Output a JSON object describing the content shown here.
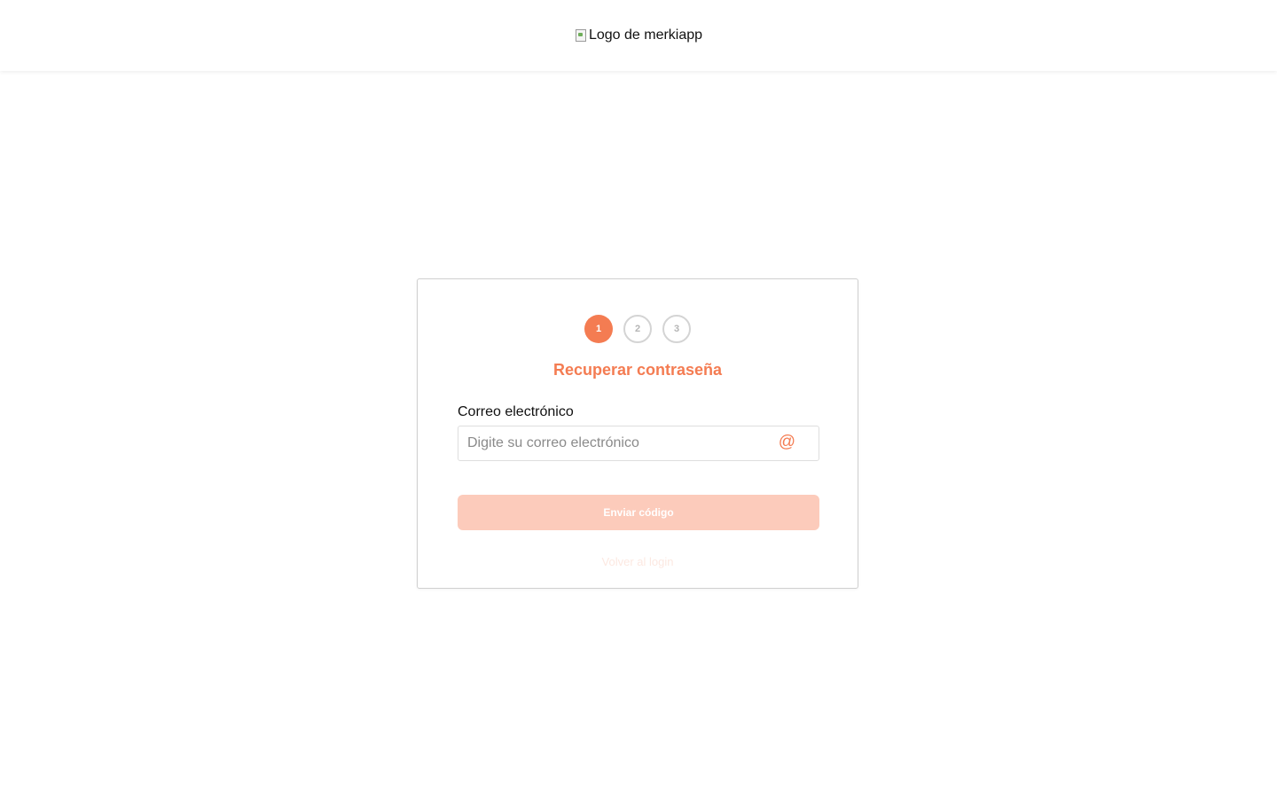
{
  "header": {
    "logo_alt": "Logo de merkiapp"
  },
  "stepper": {
    "steps": [
      "1",
      "2",
      "3"
    ],
    "active_step": 1
  },
  "form": {
    "title": "Recuperar contraseña",
    "email_label": "Correo electrónico",
    "email_value": "",
    "email_placeholder": "Digite su correo electrónico",
    "email_icon": "at-sign-icon",
    "submit_label": "Enviar código",
    "back_link": "Volver al login"
  },
  "colors": {
    "accent": "#f47c52",
    "button_disabled": "#fccbbb",
    "step_inactive_border": "#d4d4d4"
  }
}
